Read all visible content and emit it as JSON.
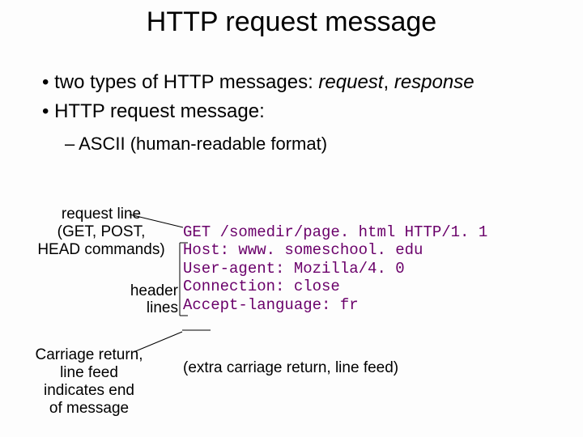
{
  "title": "HTTP request message",
  "bullets": {
    "b1_prefix": "• two types of HTTP messages: ",
    "b1_italic1": "request",
    "b1_sep": ", ",
    "b1_italic2": "response",
    "b2": "• HTTP request message:",
    "sub": "– ASCII (human-readable format)"
  },
  "labels": {
    "request_line": "request line\n(GET, POST,\nHEAD commands)",
    "header_lines": "header\nlines",
    "crlf": "Carriage return,\nline feed\nindicates end\nof message"
  },
  "http": {
    "line1": "GET /somedir/page. html HTTP/1. 1",
    "line2": "Host: www. someschool. edu",
    "line3": "User-agent: Mozilla/4. 0",
    "line4": "Connection: close",
    "line5": "Accept-language: fr"
  },
  "extra": "(extra carriage return, line feed)"
}
